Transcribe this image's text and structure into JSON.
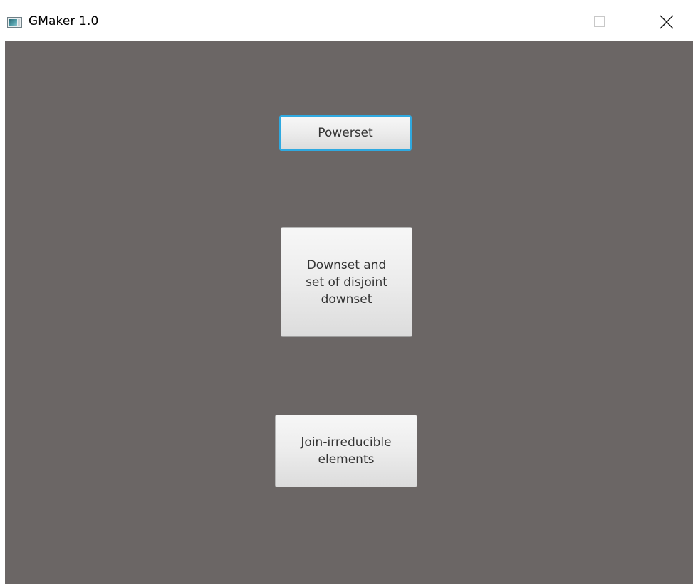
{
  "window": {
    "title": "GMaker 1.0",
    "icon": "app-icon"
  },
  "caption_buttons": {
    "minimize": "minimize-icon",
    "maximize": "maximize-icon",
    "close": "close-icon"
  },
  "colors": {
    "content_background": "#6b6665",
    "focus_ring": "#2fa9e0",
    "button_text": "#333333"
  },
  "buttons": {
    "powerset": "Powerset",
    "downset": "Downset and\nset of disjoint\ndownset",
    "join_irreducible": "Join-irreducible\nelements"
  }
}
